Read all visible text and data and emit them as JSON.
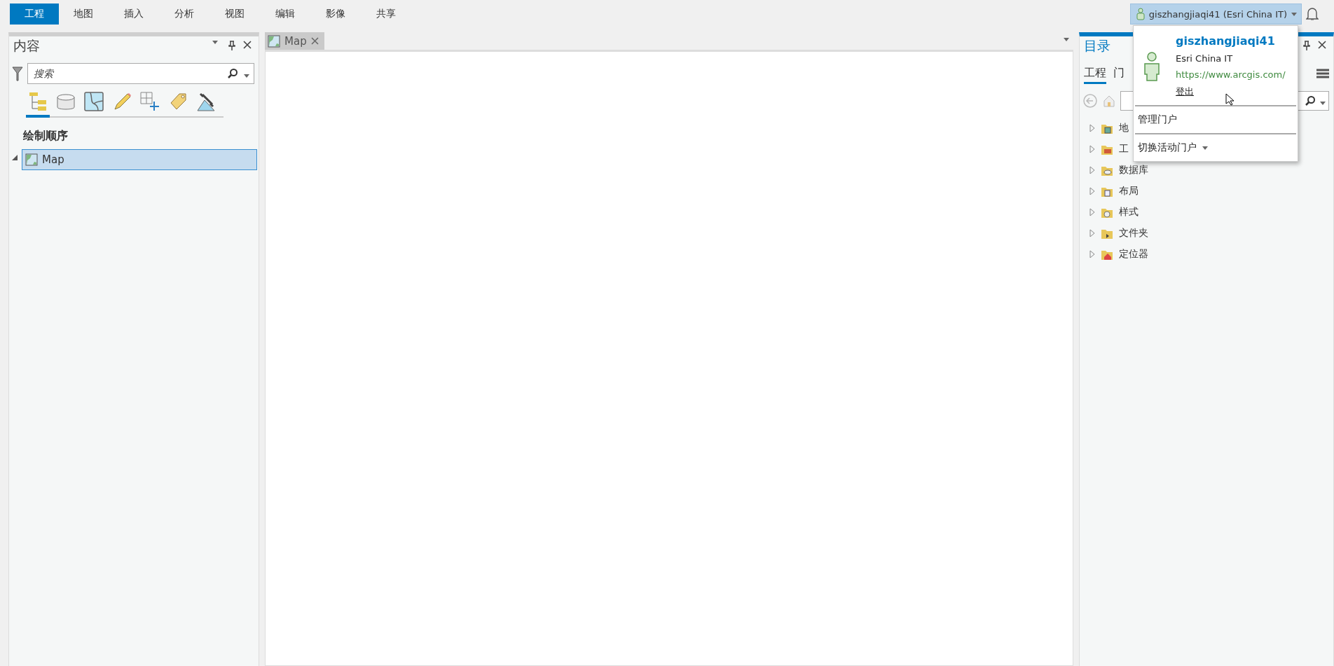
{
  "ribbon_tabs": [
    {
      "label": "工程",
      "selected": true
    },
    {
      "label": "地图",
      "selected": false
    },
    {
      "label": "插入",
      "selected": false
    },
    {
      "label": "分析",
      "selected": false
    },
    {
      "label": "视图",
      "selected": false
    },
    {
      "label": "编辑",
      "selected": false
    },
    {
      "label": "影像",
      "selected": false
    },
    {
      "label": "共享",
      "selected": false
    }
  ],
  "user_button": {
    "label": "giszhangjiaqi41 (Esri China IT)"
  },
  "contents_pane": {
    "title": "内容",
    "search": {
      "placeholder": "搜索"
    },
    "view_tabs": [
      {
        "kind": "drawing-order",
        "selected": true
      },
      {
        "kind": "data-source",
        "selected": false
      },
      {
        "kind": "selection",
        "selected": false
      },
      {
        "kind": "editing",
        "selected": false
      },
      {
        "kind": "snapping",
        "selected": false
      },
      {
        "kind": "labeling",
        "selected": false
      },
      {
        "kind": "perspective",
        "selected": false
      }
    ],
    "section_title": "绘制顺序",
    "items": [
      {
        "label": "Map",
        "selected": true,
        "expanded": true
      }
    ]
  },
  "map_tabs": [
    {
      "label": "Map",
      "selected": true
    }
  ],
  "catalog_pane": {
    "title": "目录",
    "tabs": [
      {
        "label": "工程",
        "selected": true
      },
      {
        "label": "门",
        "selected": false
      }
    ],
    "items": [
      {
        "label": "地",
        "kind": "maps"
      },
      {
        "label": "工",
        "kind": "toolboxes"
      },
      {
        "label": "数据库",
        "kind": "databases"
      },
      {
        "label": "布局",
        "kind": "layouts"
      },
      {
        "label": "样式",
        "kind": "styles"
      },
      {
        "label": "文件夹",
        "kind": "folders"
      },
      {
        "label": "定位器",
        "kind": "locators"
      }
    ]
  },
  "account_menu": {
    "username": "giszhangjiaqi41",
    "organization": "Esri China IT",
    "url": "https://www.arcgis.com/",
    "sign_out": "登出",
    "items": [
      {
        "label": "管理门户",
        "kind": "action"
      },
      {
        "label": "切换活动门户",
        "kind": "submenu"
      }
    ]
  }
}
